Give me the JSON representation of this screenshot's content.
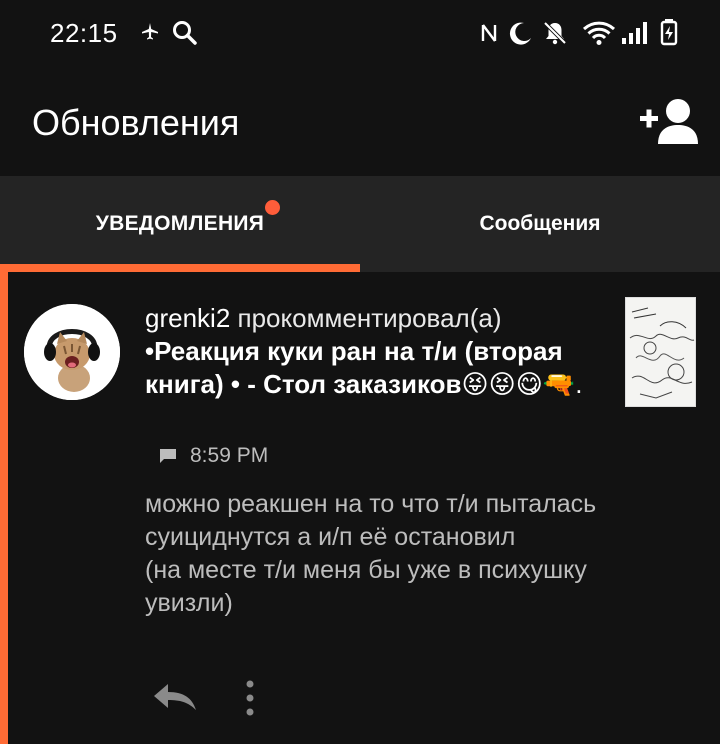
{
  "status_bar": {
    "time": "22:15"
  },
  "header": {
    "title": "Обновления",
    "add_user_icon": "add-user-icon"
  },
  "tabs": [
    {
      "label": "УВЕДОМЛЕНИЯ",
      "active": true,
      "has_badge": true
    },
    {
      "label": "Сообщения",
      "active": false,
      "has_badge": false
    }
  ],
  "notification": {
    "username": "grenki2",
    "action": " прокомментировал(а) ",
    "story": "•Реакция куки ран на т/и (вторая книга) • - Стол заказиков😝😝😋🔫",
    "trailing": ".",
    "time": "8:59 PM",
    "comment": "можно реакшен на то что т/и пыталась суициднутся а и/п её остановил\n(на месте т/и меня бы уже в психушку увизли)"
  },
  "colors": {
    "accent": "#ff6b35",
    "badge": "#ff5d3a",
    "background": "#121212",
    "tab_bar": "#242424"
  }
}
